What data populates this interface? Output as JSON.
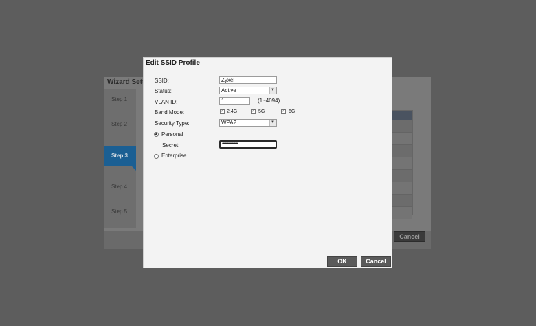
{
  "wizard": {
    "title": "Wizard Sett",
    "steps": [
      "Step 1",
      "Step 2",
      "Step 3",
      "Step 4",
      "Step 5"
    ],
    "active_step": "Step 3",
    "cancel_label": "Cancel"
  },
  "dialog": {
    "title": "Edit SSID Profile",
    "ssid": {
      "label": "SSID:",
      "value": "Zyxel"
    },
    "status": {
      "label": "Status:",
      "value": "Active"
    },
    "vlan": {
      "label": "VLAN ID:",
      "value": "1",
      "hint": "(1~4094)"
    },
    "band": {
      "label": "Band Mode:",
      "options": [
        {
          "label": "2.4G",
          "checked": true
        },
        {
          "label": "5G",
          "checked": true
        },
        {
          "label": "6G",
          "checked": true
        }
      ]
    },
    "security": {
      "label": "Security Type:",
      "value": "WPA2"
    },
    "personal": {
      "label": "Personal",
      "selected": true
    },
    "secret": {
      "label": "Secret:",
      "value": "••••••••••••••••"
    },
    "enterprise": {
      "label": "Enterprise",
      "selected": false
    },
    "ok_label": "OK",
    "cancel_label": "Cancel"
  }
}
